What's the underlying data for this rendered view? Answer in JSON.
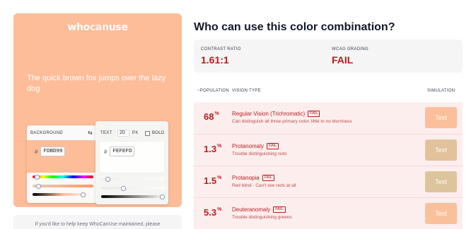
{
  "colors": {
    "background": "#FDBD99",
    "text": "#FEFEFD",
    "accent": "#b91c1c",
    "results_bg": "#fdeeee",
    "sim_colors": [
      "#fbbf9b",
      "#e2c29b",
      "#dcc59d",
      "#f8c19c"
    ]
  },
  "preview": {
    "logo_a": "who",
    "logo_b": "can",
    "logo_c": "use",
    "sample_text": "The quick brown fox jumps over the lazy dog"
  },
  "background_card": {
    "label": "BACKGROUND",
    "swap_icon": "swap-icon",
    "hash": "#",
    "hex": "FDBD99",
    "sliders": [
      {
        "name": "hue",
        "level": 0.06
      },
      {
        "name": "saturation",
        "level": 0.08
      },
      {
        "name": "lightness",
        "level": 0.77
      }
    ]
  },
  "text_card": {
    "label": "TEXT",
    "size": "20",
    "unit": "PX",
    "bold_label": "BOLD",
    "hash": "#",
    "hex": "FEFEFD",
    "sliders": [
      {
        "name": "hue",
        "level": 0.09
      },
      {
        "name": "saturation",
        "level": 0.33
      },
      {
        "name": "lightness",
        "level": 0.97
      }
    ]
  },
  "footer": {
    "text": "If you'd like to help keep WhoCanUse maintained, please"
  },
  "main": {
    "title": "Who can use this color combination?",
    "contrast_label": "CONTRAST RATIO",
    "contrast_value": "1.61:1",
    "wcag_label": "WCAG GRADING",
    "wcag_value": "FAIL",
    "col_population": "~POPULATION",
    "col_vision": "VISION TYPE",
    "col_simulation": "SIMULATION"
  },
  "rows": [
    {
      "pct": "68",
      "sym": "%",
      "name": "Regular Vision (Trichromatic)",
      "badge": "FAIL",
      "desc": "Can distinguish all three primary color, little to no blurriness",
      "sim": "Text"
    },
    {
      "pct": "1.3",
      "sym": "%",
      "name": "Protanomaly",
      "badge": "FAIL",
      "desc": "Trouble distinguishing reds",
      "sim": "Text"
    },
    {
      "pct": "1.5",
      "sym": "%",
      "name": "Protanopia",
      "badge": "FAIL",
      "desc": "Red blind - Can't see reds at all",
      "sim": "Text"
    },
    {
      "pct": "5.3",
      "sym": "%",
      "name": "Deuteranomaly",
      "badge": "FAIL",
      "desc": "Trouble distinguishing greens",
      "sim": "Text"
    }
  ]
}
